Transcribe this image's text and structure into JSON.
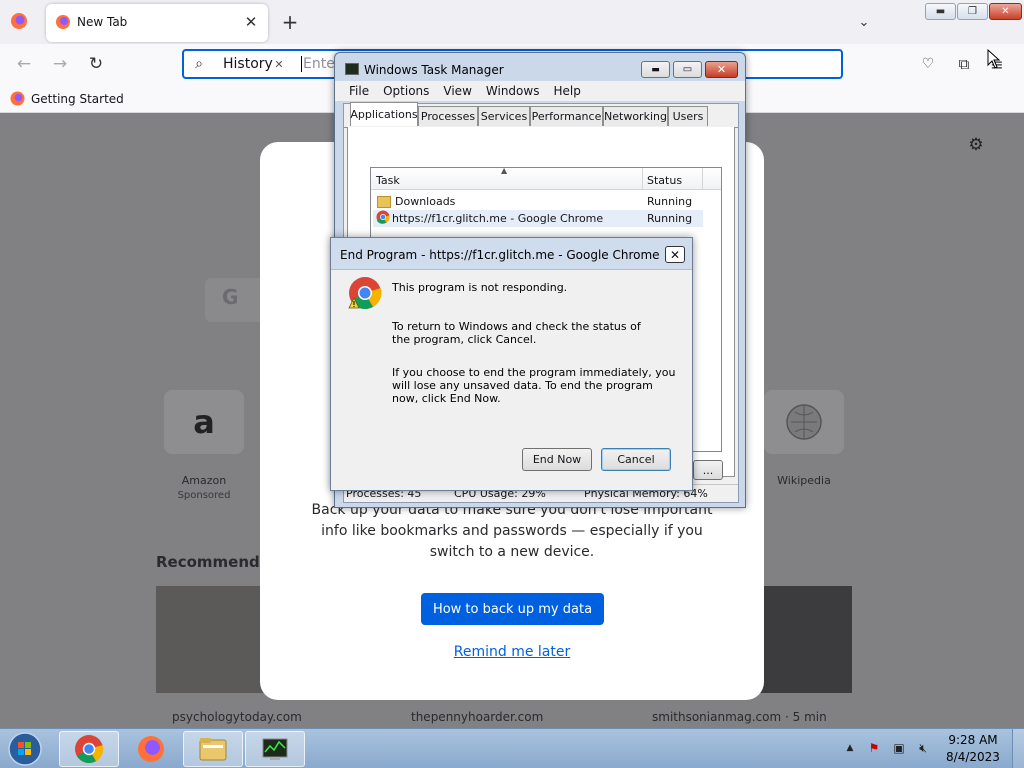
{
  "browser": {
    "tab_title": "New Tab",
    "url_chip": "History",
    "url_placeholder": "Enter",
    "bookmark": "Getting Started"
  },
  "page": {
    "modal_text_line1": "Back up your data to make sure you don't lose important",
    "modal_text_line2": "info like bookmarks and passwords — especially if you",
    "modal_text_line3": "switch to a new device.",
    "primary_button": "How to back up my data",
    "secondary_link": "Remind me later",
    "top_sites": [
      {
        "name": "Amazon",
        "sub": "Sponsored"
      },
      {
        "name": "Wikipedia",
        "sub": ""
      }
    ],
    "recommended_heading": "Recommende",
    "card_sources": [
      "psychologytoday.com",
      "thepennyhoarder.com",
      "smithsonianmag.com · 5 min"
    ]
  },
  "task_manager": {
    "title": "Windows Task Manager",
    "menu": [
      "File",
      "Options",
      "View",
      "Windows",
      "Help"
    ],
    "tabs": [
      "Applications",
      "Processes",
      "Services",
      "Performance",
      "Networking",
      "Users"
    ],
    "columns": [
      "Task",
      "Status"
    ],
    "rows": [
      {
        "task": "Downloads",
        "status": "Running"
      },
      {
        "task": "https://f1cr.glitch.me - Google Chrome",
        "status": "Running"
      }
    ],
    "status_bar": [
      "Processes: 45",
      "CPU Usage: 29%",
      "Physical Memory: 64%"
    ],
    "partial_button": "..."
  },
  "dialog": {
    "title": "End Program - https://f1cr.glitch.me - Google Chrome",
    "p1": "This program is not responding.",
    "p2": "To return to Windows and check the status of the program, click Cancel.",
    "p3": "If you choose to end the program immediately, you will lose any unsaved data. To end the program now, click End Now.",
    "end_now": "End Now",
    "cancel": "Cancel"
  },
  "taskbar": {
    "time": "9:28 AM",
    "date": "8/4/2023"
  }
}
